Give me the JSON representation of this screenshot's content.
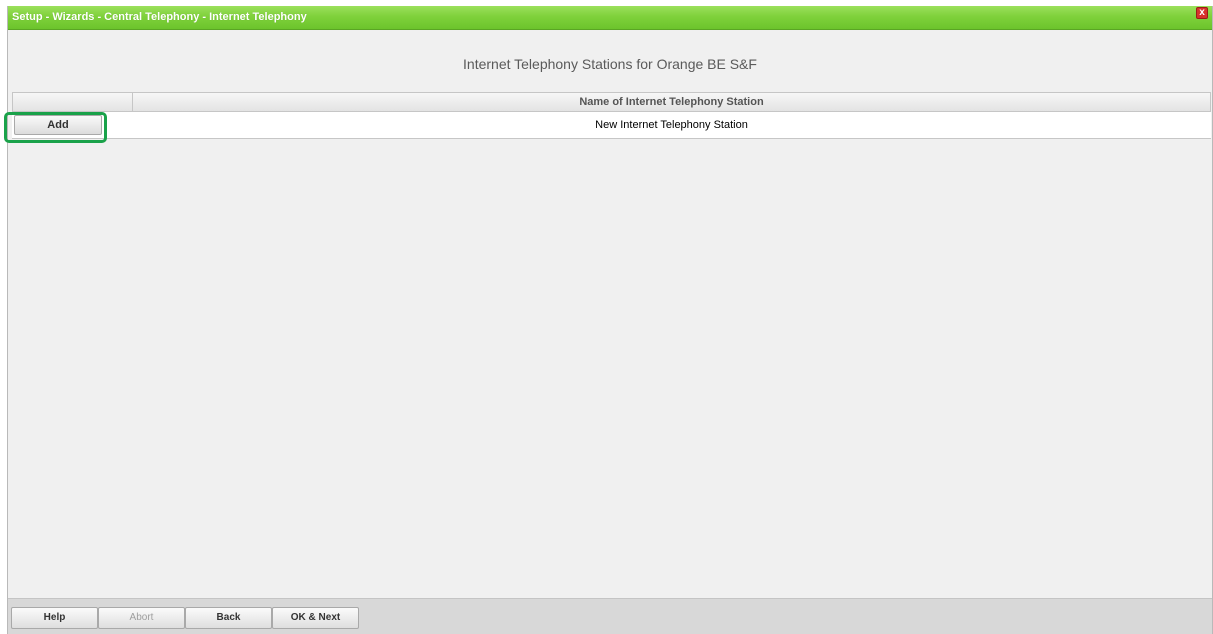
{
  "window": {
    "title": "Setup - Wizards - Central Telephony - Internet Telephony",
    "close_symbol": "x"
  },
  "page": {
    "heading": "Internet Telephony Stations for Orange BE S&F"
  },
  "table": {
    "columns": [
      "",
      "Name of Internet Telephony Station"
    ],
    "rows": [
      {
        "button_label": "Add",
        "name": "New Internet Telephony Station"
      }
    ]
  },
  "footer": {
    "buttons": [
      {
        "label": "Help",
        "enabled": true
      },
      {
        "label": "Abort",
        "enabled": false
      },
      {
        "label": "Back",
        "enabled": true
      },
      {
        "label": "OK & Next",
        "enabled": true
      }
    ]
  },
  "colors": {
    "titlebar": "#7fd13b",
    "highlight": "#1aa24a",
    "close": "#d6322c"
  },
  "icons": {
    "close": "close-icon"
  }
}
